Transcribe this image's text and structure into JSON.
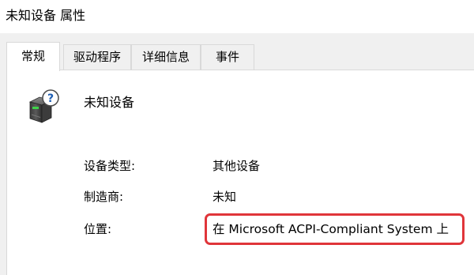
{
  "window": {
    "title": "未知设备 属性"
  },
  "tabs": [
    {
      "label": "常规",
      "active": true
    },
    {
      "label": "驱动程序",
      "active": false
    },
    {
      "label": "详细信息",
      "active": false
    },
    {
      "label": "事件",
      "active": false
    }
  ],
  "device": {
    "icon": "unknown-device-icon",
    "name": "未知设备"
  },
  "properties": [
    {
      "label": "设备类型:",
      "value": "其他设备"
    },
    {
      "label": "制造商:",
      "value": "未知"
    },
    {
      "label": "位置:",
      "value": "在 Microsoft ACPI-Compliant System 上"
    }
  ],
  "colors": {
    "highlight": "#e0353a",
    "panel_background": "#ffffff",
    "window_background": "#f0f0f0"
  }
}
